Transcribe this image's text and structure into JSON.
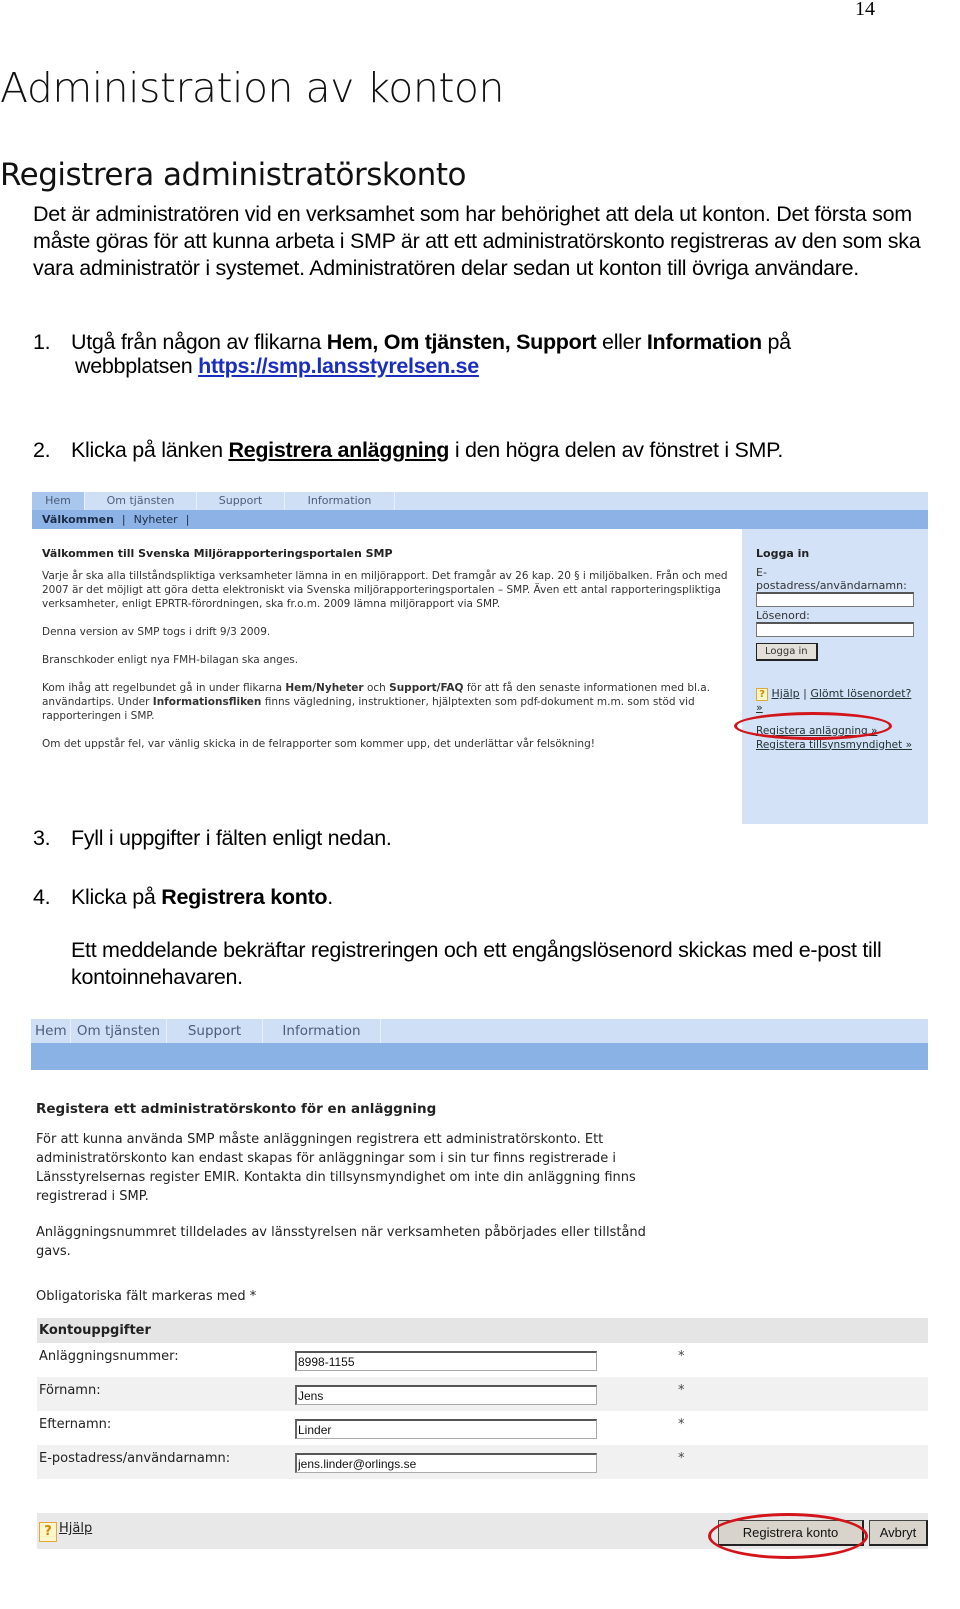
{
  "page_number": "14",
  "heading1": "Administration av konton",
  "heading2": "Registrera administratörskonto",
  "intro": "Det är administratören vid en verksamhet som har behörighet att dela ut konton. Det första som måste göras för att kunna arbeta i SMP är att ett administratörskonto registreras av den som ska vara administratör i systemet. Administratören delar sedan ut konton till övriga användare.",
  "steps": [
    {
      "num": "1.",
      "text_before": "Utgå från någon av flikarna ",
      "bold1": "Hem, Om tjänsten, Support",
      "text_mid": " eller ",
      "bold2": "Information",
      "text_after": " på",
      "cont": "webbplatsen ",
      "link": "https://smp.lansstyrelsen.se"
    },
    {
      "num": "2.",
      "text_before": "Klicka på länken ",
      "link": "Registrera anläggning",
      "text_after": " i den högra delen av fönstret i SMP."
    },
    {
      "num": "3.",
      "text": "Fyll i uppgifter i fälten enligt nedan."
    },
    {
      "num": "4.",
      "text_before": "Klicka på ",
      "bold": "Registrera konto",
      "text_after": ".",
      "note": "Ett meddelande bekräftar registreringen och ett engångslösenord skickas med e-post till kontoinnehavaren."
    }
  ],
  "screenshot1": {
    "tabs": [
      "Hem",
      "Om tjänsten",
      "Support",
      "Information"
    ],
    "active_tab": "Hem",
    "subnav": [
      "Välkommen",
      "Nyheter"
    ],
    "title": "Välkommen till Svenska Miljörapporteringsportalen SMP",
    "paragraphs": [
      "Varje år ska alla tillståndspliktiga verksamheter lämna in en miljörapport. Det framgår av 26 kap. 20 § i miljöbalken. Från och med 2007 är det möjligt att göra detta elektroniskt via Svenska miljörapporteringsportalen – SMP. Även ett antal rapporteringspliktiga verksamheter, enligt EPRTR-förordningen, ska fr.o.m. 2009 lämna miljörapport via SMP.",
      "Denna version av SMP togs i drift 9/3 2009.",
      "Branschkoder enligt nya FMH-bilagan ska anges."
    ],
    "para_reminder": {
      "t1": "Kom ihåg att regelbundet gå in under flikarna ",
      "b1": "Hem/Nyheter",
      "t2": " och ",
      "b2": "Support/FAQ",
      "t3": " för att få den senaste informationen med bl.a. användartips. Under ",
      "b3": "Informationsfliken",
      "t4": " finns vägledning, instruktioner, hjälptexten som pdf-dokument m.m. som stöd vid rapporteringen i SMP."
    },
    "para_last": "Om det uppstår fel, var vänlig skicka in de felrapporter som kommer upp, det underlättar vår felsökning!",
    "login": {
      "title": "Logga in",
      "email_label": "E-postadress/användarnamn:",
      "email_value": "",
      "password_label": "Lösenord:",
      "password_value": "",
      "button": "Logga in",
      "help": "Hjälp",
      "separator": "|",
      "forgot": "Glömt lösenordet? »",
      "register_facility": "Registera anläggning »",
      "register_authority": "Registera tillsynsmyndighet »"
    }
  },
  "screenshot2": {
    "tabs": [
      "Hem",
      "Om tjänsten",
      "Support",
      "Information"
    ],
    "title": "Registera ett administratörskonto för en anläggning",
    "para1": "För att kunna använda SMP måste anläggningen registrera ett administratörskonto. Ett administratörskonto kan endast skapas för anläggningar som i sin tur finns registrerade i Länsstyrelsernas register EMIR. Kontakta din tillsynsmyndighet om inte din anläggning finns registrerad i SMP.",
    "para2": "Anläggningsnummret tilldelades av länsstyrelsen när verksamheten påbörjades eller tillstånd gavs.",
    "para3": "Obligatoriska fält markeras med *",
    "section_title": "Kontouppgifter",
    "fields": [
      {
        "label": "Anläggningsnummer:",
        "value": "8998-1155",
        "required": "*"
      },
      {
        "label": "Förnamn:",
        "value": "Jens",
        "required": "*"
      },
      {
        "label": "Efternamn:",
        "value": "Linder",
        "required": "*"
      },
      {
        "label": "E-postadress/användarnamn:",
        "value": "jens.linder@orlings.se",
        "required": "*"
      }
    ],
    "help": "Hjälp",
    "register_button": "Registrera konto",
    "cancel_button": "Avbryt"
  },
  "annotation_color": "#d3141b",
  "link_color": "#1a2dbd"
}
